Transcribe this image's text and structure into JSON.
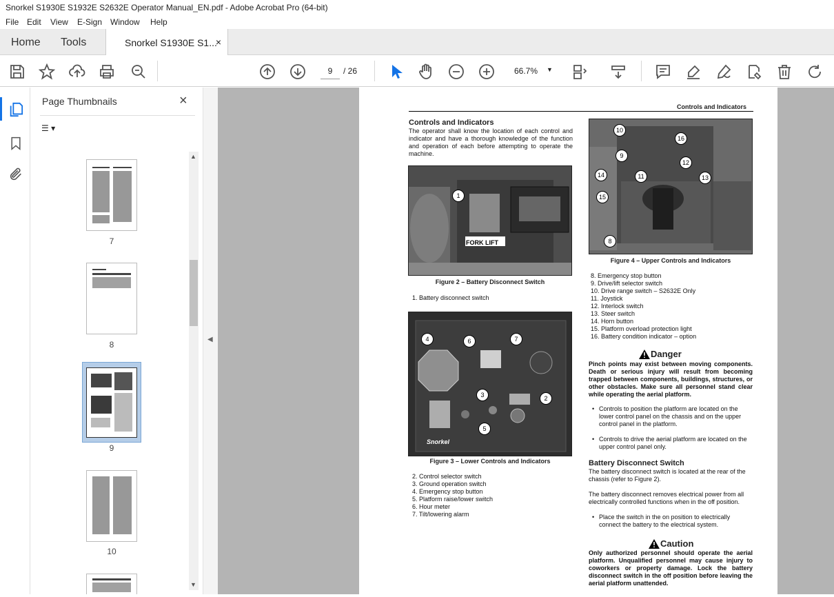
{
  "window": {
    "title": "Snorkel S1930E S1932E S2632E Operator Manual_EN.pdf - Adobe Acrobat Pro (64-bit)"
  },
  "menu": [
    "File",
    "Edit",
    "View",
    "E-Sign",
    "Window",
    "Help"
  ],
  "tabs": {
    "home": "Home",
    "tools": "Tools",
    "document": "Snorkel S1930E S1...",
    "close": "×"
  },
  "toolbar": {
    "current_page": "9",
    "total_pages": "/ 26",
    "zoom": "66.7%"
  },
  "panel": {
    "title": "Page Thumbnails",
    "close": "×",
    "options": "☰ ▾"
  },
  "thumbnails": [
    {
      "label": "7"
    },
    {
      "label": "8"
    },
    {
      "label": "9"
    },
    {
      "label": "10"
    }
  ],
  "document": {
    "header": "Controls and Indicators",
    "section_title": "Controls and Indicators",
    "intro": "The operator shall know the location of each control and indicator and have a thorough knowledge of the function and operation of each before attempting to operate the machine.",
    "fig2": {
      "caption": "Figure 2 – Battery Disconnect Switch",
      "callouts": [
        "1"
      ],
      "plate": "FORK LIFT"
    },
    "fig2_items": [
      "1. Battery disconnect switch"
    ],
    "fig3": {
      "caption": "Figure 3 – Lower Controls and Indicators",
      "callouts": [
        "4",
        "6",
        "7",
        "3",
        "2",
        "5"
      ],
      "brand": "Snorkel"
    },
    "fig3_items": [
      "2. Control selector switch",
      "3. Ground operation switch",
      "4. Emergency stop button",
      "5. Platform raise/lower switch",
      "6. Hour meter",
      "7. Tilt/lowering alarm"
    ],
    "fig4": {
      "caption": "Figure 4 – Upper Controls and Indicators",
      "callouts": [
        "10",
        "16",
        "9",
        "12",
        "14",
        "11",
        "13",
        "15",
        "8"
      ]
    },
    "fig4_items": [
      "8. Emergency stop button",
      "9. Drive/lift selector switch",
      "10. Drive range switch – S2632E Only",
      "11. Joystick",
      "12. Interlock switch",
      "13. Steer switch",
      "14. Horn button",
      "15. Platform overload protection light",
      "16. Battery condition indicator – option"
    ],
    "danger": {
      "title": "Danger",
      "text": "Pinch points may exist between moving components. Death or serious injury will result from becoming trapped between components, buildings, structures, or other obstacles. Make sure all personnel stand clear while operating the aerial platform.",
      "bullets": [
        "Controls to position the platform are located on the lower control panel on the chassis and on the upper control panel in the platform.",
        "Controls to drive the aerial platform are located on the upper control panel only."
      ]
    },
    "battery": {
      "title": "Battery Disconnect Switch",
      "p1": "The battery disconnect switch is located at the rear of the chassis (refer to Figure 2).",
      "p2": "The battery disconnect removes electrical power from all electrically controlled functions when in the off position.",
      "bullet": "Place the switch in the on position to electrically connect the battery to the electrical system."
    },
    "caution": {
      "title": "Caution",
      "text": "Only authorized personnel should operate the aerial platform. Unqualified personnel may cause injury to coworkers or property damage. Lock the battery disconnect switch in the off position before leaving the aerial platform unattended."
    }
  }
}
